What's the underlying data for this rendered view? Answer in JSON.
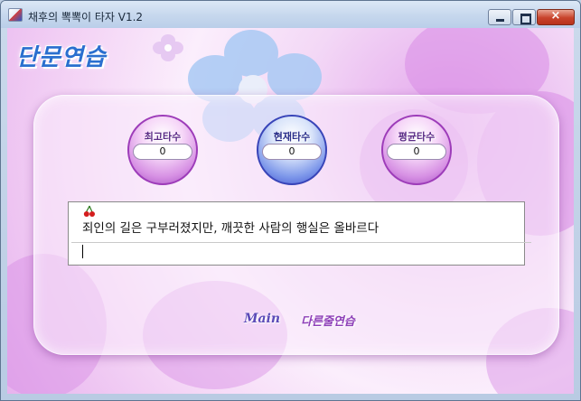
{
  "window": {
    "title": "채후의 뽁뽁이 타자 V1.2"
  },
  "controls": {
    "minimize": "minimize",
    "maximize": "maximize",
    "close": "×"
  },
  "header": {
    "logo": "단문연습"
  },
  "stats": [
    {
      "label": "최고타수",
      "value": "0",
      "style": "pink"
    },
    {
      "label": "현재타수",
      "value": "0",
      "style": "blue"
    },
    {
      "label": "평균타수",
      "value": "0",
      "style": "pink"
    }
  ],
  "practice": {
    "icon": "cherry-icon",
    "sentence": "죄인의 길은 구부러졌지만, 깨끗한 사람의 행실은 올바르다",
    "input_value": ""
  },
  "nav": {
    "main": "Main",
    "long": "다른줄연습"
  },
  "colors": {
    "accent_blue": "#2a6fcf",
    "accent_purple": "#8e3fb8"
  }
}
